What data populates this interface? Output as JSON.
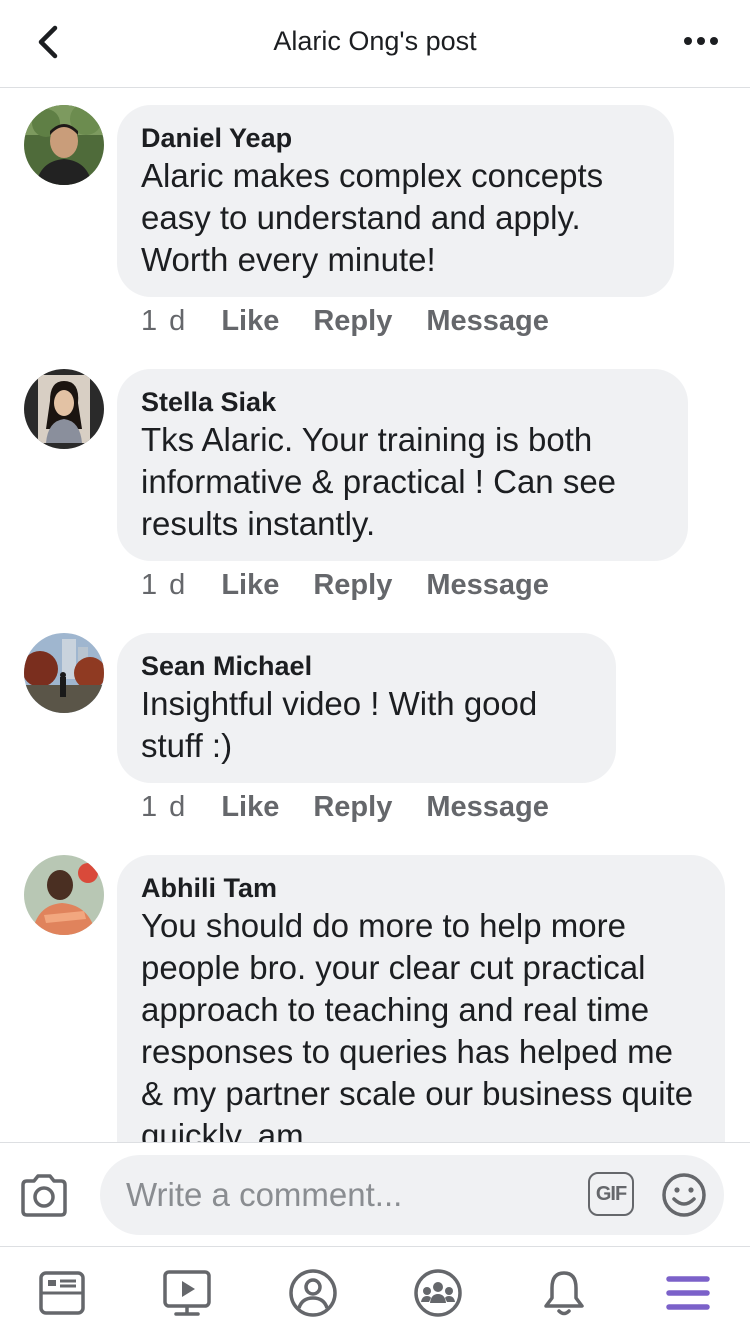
{
  "header": {
    "title": "Alaric Ong's post",
    "back_icon": "chevron-left-icon",
    "more_icon": "more-dots-icon"
  },
  "comments": [
    {
      "author": "Daniel Yeap",
      "text": "Alaric makes complex concepts easy to understand and apply. Worth every minute!",
      "time": "1 d",
      "like": "Like",
      "reply": "Reply",
      "message": "Message"
    },
    {
      "author": "Stella Siak",
      "text": "Tks Alaric. Your training is both informative & practical ! Can see results instantly.",
      "time": "1 d",
      "like": "Like",
      "reply": "Reply",
      "message": "Message"
    },
    {
      "author": "Sean Michael",
      "text": "Insightful video !  With good stuff :)",
      "time": "1 d",
      "like": "Like",
      "reply": "Reply",
      "message": "Message"
    },
    {
      "author": "Abhili Tam",
      "text": "You should do more to help more people bro. your clear cut practical approach to teaching and real time responses to queries has helped me & my partner scale our business quite quickly. am"
    }
  ],
  "composer": {
    "placeholder": "Write a comment...",
    "gif_label": "GIF",
    "camera_icon": "camera-icon",
    "emoji_icon": "smiley-icon"
  },
  "bottom_nav": {
    "items": [
      "news-feed-icon",
      "watch-icon",
      "profile-icon",
      "groups-icon",
      "notifications-icon",
      "menu-icon"
    ],
    "active_color": "#7b61c9",
    "inactive_color": "#65676b"
  },
  "colors": {
    "bubble": "#f0f1f3",
    "meta_text": "#65676b",
    "text": "#1c1e21"
  }
}
